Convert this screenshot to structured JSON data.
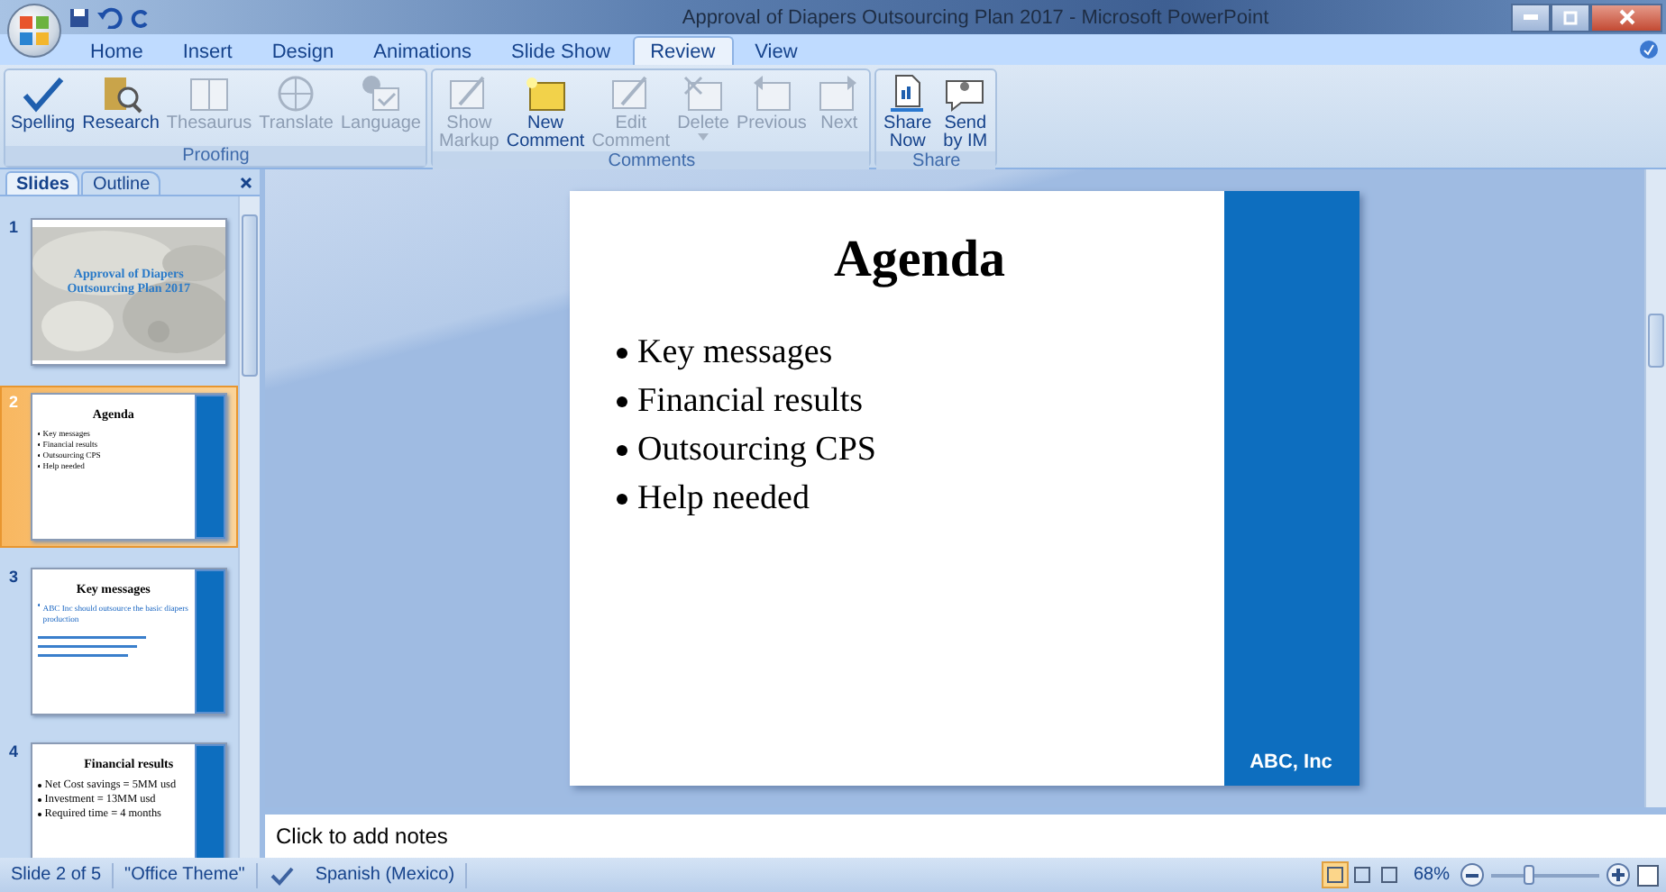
{
  "window": {
    "title": "Approval of Diapers Outsourcing Plan 2017 - Microsoft PowerPoint"
  },
  "tabs": [
    {
      "label": "Home",
      "selected": false
    },
    {
      "label": "Insert",
      "selected": false
    },
    {
      "label": "Design",
      "selected": false
    },
    {
      "label": "Animations",
      "selected": false
    },
    {
      "label": "Slide Show",
      "selected": false
    },
    {
      "label": "Review",
      "selected": true
    },
    {
      "label": "View",
      "selected": false
    }
  ],
  "ribbon": {
    "groups": [
      {
        "label": "Proofing",
        "buttons": [
          {
            "label": "Spelling",
            "disabled": false
          },
          {
            "label": "Research",
            "disabled": false
          },
          {
            "label": "Thesaurus",
            "disabled": true
          },
          {
            "label": "Translate",
            "disabled": true
          },
          {
            "label": "Language",
            "disabled": true
          }
        ]
      },
      {
        "label": "Comments",
        "buttons": [
          {
            "label": "Show\nMarkup",
            "disabled": true
          },
          {
            "label": "New\nComment",
            "disabled": false
          },
          {
            "label": "Edit\nComment",
            "disabled": true
          },
          {
            "label": "Delete",
            "disabled": true
          },
          {
            "label": "Previous",
            "disabled": true
          },
          {
            "label": "Next",
            "disabled": true
          }
        ]
      },
      {
        "label": "Share",
        "buttons": [
          {
            "label": "Share\nNow",
            "disabled": false
          },
          {
            "label": "Send\nby IM",
            "disabled": false
          }
        ]
      }
    ]
  },
  "pane_tabs": [
    {
      "label": "Slides",
      "selected": true
    },
    {
      "label": "Outline",
      "selected": false
    }
  ],
  "thumbnails": [
    {
      "number": "1",
      "selected": false,
      "kind": "title",
      "title": "Approval of Diapers Outsourcing Plan 2017"
    },
    {
      "number": "2",
      "selected": true,
      "kind": "bullets",
      "title": "Agenda",
      "bullets": [
        "Key messages",
        "Financial results",
        "Outsourcing CPS",
        "Help needed"
      ]
    },
    {
      "number": "3",
      "selected": false,
      "kind": "bullets",
      "title": "Key messages",
      "bullets": [
        "ABC Inc should outsource the basic diapers production"
      ]
    },
    {
      "number": "4",
      "selected": false,
      "kind": "large",
      "title": "Financial results",
      "bullets": [
        "Net Cost savings = 5MM usd",
        "Investment = 13MM usd",
        "Required time = 4 months"
      ]
    }
  ],
  "slide": {
    "title": "Agenda",
    "bullets": [
      "Key messages",
      "Financial results",
      "Outsourcing CPS",
      "Help needed"
    ],
    "footer": "ABC, Inc"
  },
  "notes": {
    "placeholder": "Click to add notes"
  },
  "status_bar": {
    "slide_info": "Slide 2 of 5",
    "theme": "\"Office Theme\"",
    "language": "Spanish (Mexico)",
    "views": [
      {
        "selected": true
      },
      {
        "selected": false
      },
      {
        "selected": false
      }
    ],
    "zoom": "68%",
    "zoom_slider": {
      "level": 0.35
    }
  }
}
